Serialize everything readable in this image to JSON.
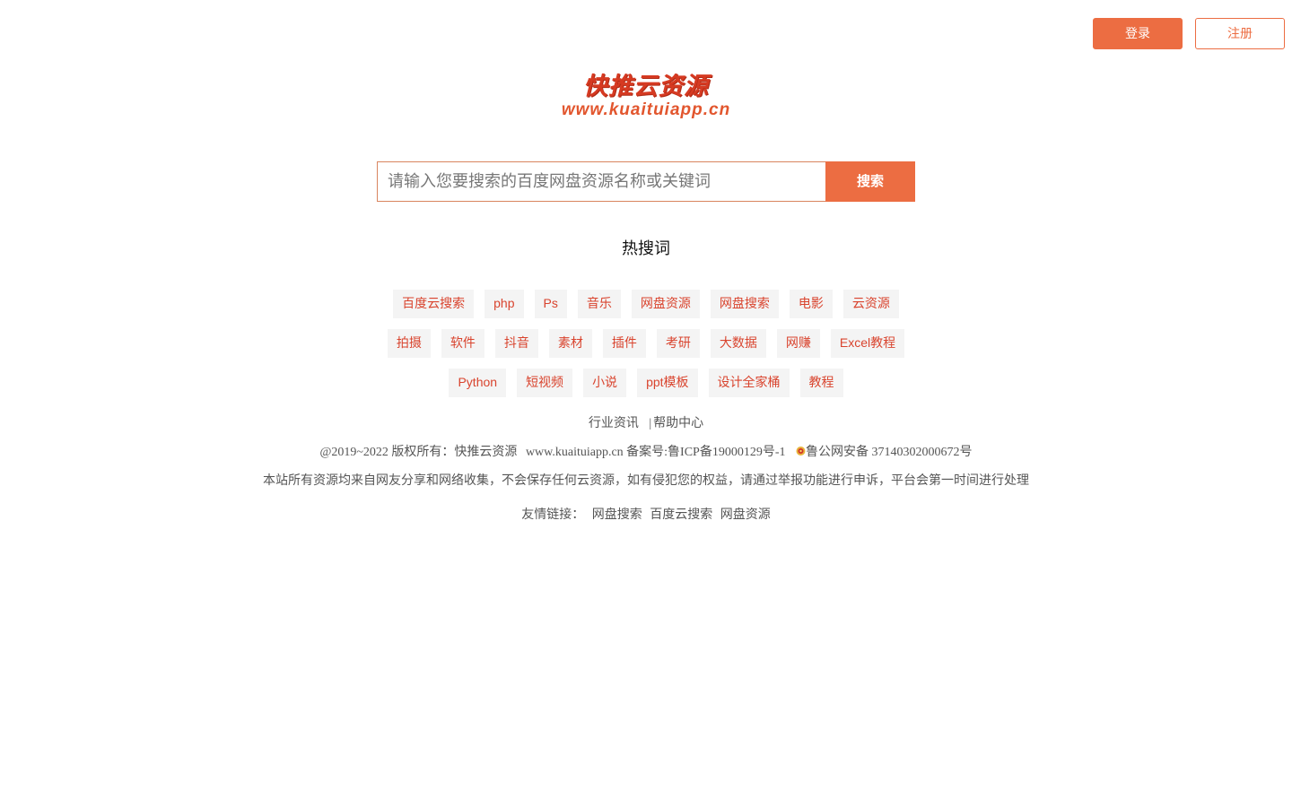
{
  "header": {
    "login_label": "登录",
    "register_label": "注册"
  },
  "logo": {
    "title": "快推云资源",
    "url": "www.kuaituiapp.cn"
  },
  "search": {
    "placeholder": "请输入您要搜索的百度网盘资源名称或关键词",
    "button_label": "搜索"
  },
  "hot": {
    "title": "热搜词",
    "rows": [
      [
        "百度云搜索",
        "php",
        "Ps",
        "音乐",
        "网盘资源",
        "网盘搜索",
        "电影",
        "云资源"
      ],
      [
        "拍摄",
        "软件",
        "抖音",
        "素材",
        "插件",
        "考研",
        "大数据",
        "网赚",
        "Excel教程"
      ],
      [
        "Python",
        "短视频",
        "小说",
        "ppt模板",
        "设计全家桶",
        "教程"
      ]
    ]
  },
  "footer": {
    "links": {
      "industry_news": "行业资讯",
      "separator": "|",
      "help_center": "帮助中心"
    },
    "copyright": "@2019~2022 版权所有：快推云资源",
    "domain": "www.kuaituiapp.cn",
    "icp": "备案号:鲁ICP备19000129号-1",
    "police": "鲁公网安备 37140302000672号",
    "disclaimer": "本站所有资源均来自网友分享和网络收集，不会保存任何云资源，如有侵犯您的权益，请通过举报功能进行申诉，平台会第一时间进行处理",
    "friend_label": "友情链接：",
    "friend_links": [
      "网盘搜索",
      "百度云搜索",
      "网盘资源"
    ]
  },
  "colors": {
    "accent": "#ec6d42",
    "tag_text": "#d9442e",
    "tag_bg": "#f4f4f4"
  }
}
